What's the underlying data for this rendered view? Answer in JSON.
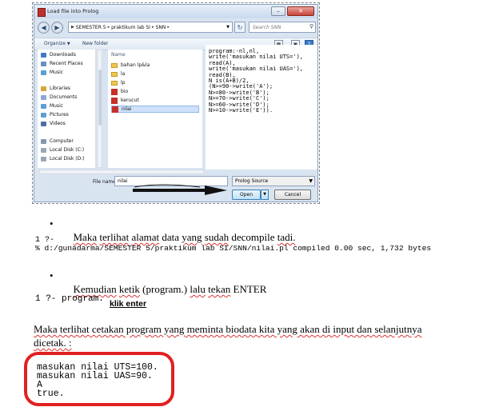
{
  "dialog": {
    "title": "Load file into Prolog",
    "breadcrumb": [
      "SEMESTER 5",
      "praktikum lab SI",
      "SNN"
    ],
    "search_placeholder": "Search SNN",
    "toolbar": {
      "organize": "Organize",
      "new_folder": "New folder"
    },
    "nav_items": [
      {
        "label": "Downloads",
        "icon": "downloads-icon",
        "color": "#3e79c7"
      },
      {
        "label": "Recent Places",
        "icon": "recent-places-icon",
        "color": "#6b8fbf"
      },
      {
        "label": "Music",
        "icon": "music-icon",
        "color": "#5aa0d6"
      },
      {
        "label": "Libraries",
        "icon": "libraries-icon",
        "color": "#d7a53a"
      },
      {
        "label": "Documents",
        "icon": "documents-icon",
        "color": "#8aa9cf"
      },
      {
        "label": "Music",
        "icon": "music-icon",
        "color": "#5aa0d6"
      },
      {
        "label": "Pictures",
        "icon": "pictures-icon",
        "color": "#5f9ed1"
      },
      {
        "label": "Videos",
        "icon": "videos-icon",
        "color": "#4f6fa8"
      },
      {
        "label": "Computer",
        "icon": "computer-icon",
        "color": "#7f96b4"
      },
      {
        "label": "Local Disk (C:)",
        "icon": "disk-icon",
        "color": "#9aa6b5"
      },
      {
        "label": "Local Disk (D:)",
        "icon": "disk-icon",
        "color": "#9aa6b5"
      }
    ],
    "column_name": "Name",
    "files": [
      {
        "label": "bahan lp&la",
        "type": "folder"
      },
      {
        "label": "la",
        "type": "folder"
      },
      {
        "label": "lp",
        "type": "folder"
      },
      {
        "label": "bio",
        "type": "prolog"
      },
      {
        "label": "kerucut",
        "type": "prolog"
      },
      {
        "label": "nilai",
        "type": "prolog",
        "selected": true
      }
    ],
    "preview_code": [
      "program:-nl,nl,",
      "write('masukan nilai UTS='),",
      "read(A),",
      "write('masukan nilai UAS='),",
      "read(B),",
      "N is(A+B)/2,",
      "(N>=90->write('A');",
      "N>=80->write('B');",
      "N>=70->write('C');",
      "N>=60->write('D');",
      "N>=10->write('E'))."
    ],
    "file_name_label": "File name:",
    "file_name_value": "nilai",
    "file_type": "Prolog Source",
    "open_label": "Open",
    "cancel_label": "Cancel"
  },
  "doc": {
    "bullet1_parts": [
      "Maka",
      " ",
      "terlihat",
      " ",
      "alamat",
      " data ",
      "yang",
      " ",
      "sudah",
      " decompile ",
      "tadi."
    ],
    "console1_line1": "1 ?-",
    "console1_line2": "% d:/gunadarma/SEMESTER 5/praktikum lab SI/SNN/nilai.pl compiled 0.00 sec, 1,732 bytes",
    "bullet2_parts": [
      "Kemudian",
      " ",
      "ketik",
      " (program.) ",
      "lalu",
      " ",
      "tekan",
      " ENTER"
    ],
    "console2": "1 ?- program.",
    "klik_enter": "klik enter",
    "para_line1": "Maka terlihat cetakan program yang meminta biodata kita yang akan di input dan selanjutnya",
    "para_line2": "dicetak. :",
    "output_lines": [
      "masukan nilai UTS=100.",
      "masukan nilai UAS=90.",
      "A",
      "true."
    ]
  },
  "colors": {
    "highlight_box": "#e02020",
    "spell_underline": "#d33"
  }
}
